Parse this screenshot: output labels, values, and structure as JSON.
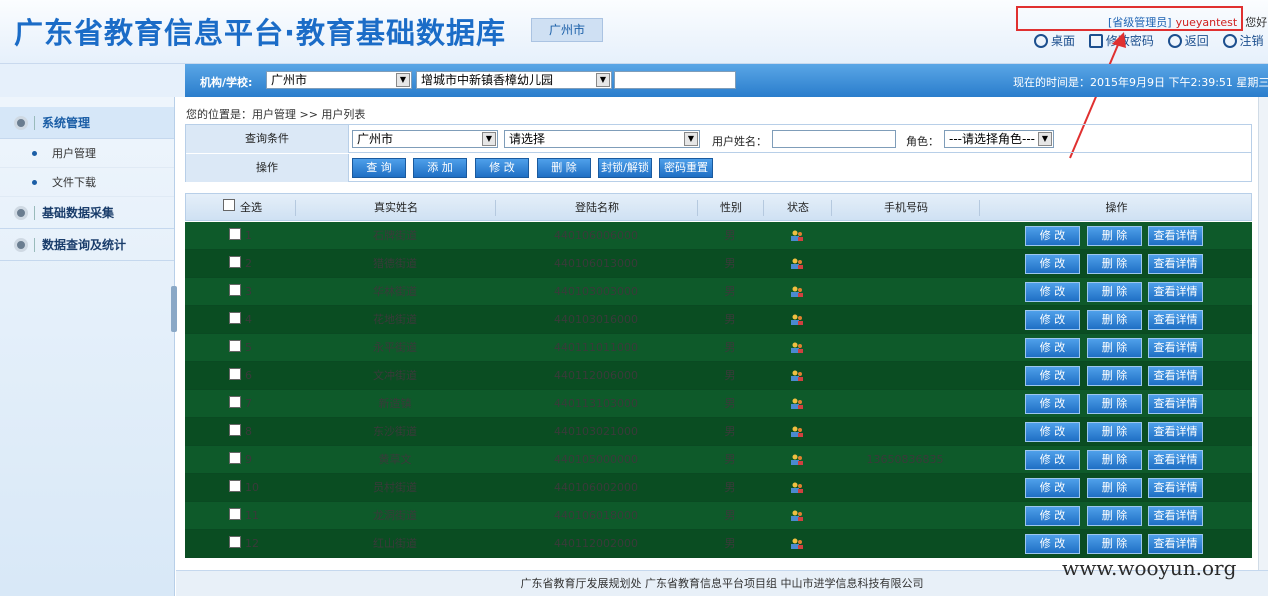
{
  "header": {
    "title": "广东省教育信息平台·教育基础数据库",
    "city": "广州市",
    "role": "[省级管理员]",
    "username": "yueyantest",
    "greeting": "您好",
    "links": [
      "桌面",
      "修改密码",
      "返回",
      "注销"
    ]
  },
  "orgbar": {
    "label": "机构/学校:",
    "city_select": "广州市",
    "school_select": "增城市中新镇香樟幼儿园",
    "time": "现在的时间是：2015年9月9日 下午2:39:51 星期三"
  },
  "sidebar": {
    "sections": [
      {
        "label": "系统管理",
        "items": [
          "用户管理",
          "文件下载"
        ]
      },
      {
        "label": "基础数据采集",
        "items": []
      },
      {
        "label": "数据查询及统计",
        "items": []
      }
    ]
  },
  "breadcrumb": "您的位置是：用户管理 >> 用户列表",
  "query": {
    "label_conditions": "查询条件",
    "label_actions": "操作",
    "city": "广州市",
    "select_placeholder": "请选择",
    "username_label": "用户姓名：",
    "role_label": "角色：",
    "role_select": "---请选择角色---",
    "buttons": [
      "查 询",
      "添 加",
      "修 改",
      "删 除",
      "封锁/解锁",
      "密码重置"
    ]
  },
  "table": {
    "headers": [
      "全选",
      "真实姓名",
      "登陆名称",
      "性别",
      "状态",
      "手机号码",
      "操作"
    ],
    "row_actions": [
      "修 改",
      "删 除",
      "查看详情"
    ],
    "rows": [
      {
        "no": "1",
        "name": "石牌街道",
        "login": "440106006000",
        "gender": "男",
        "phone": ""
      },
      {
        "no": "2",
        "name": "猎德街道",
        "login": "440106013000",
        "gender": "男",
        "phone": ""
      },
      {
        "no": "3",
        "name": "华林街道",
        "login": "440103003000",
        "gender": "男",
        "phone": ""
      },
      {
        "no": "4",
        "name": "花地街道",
        "login": "440103016000",
        "gender": "男",
        "phone": ""
      },
      {
        "no": "5",
        "name": "永平街道",
        "login": "440111011000",
        "gender": "男",
        "phone": ""
      },
      {
        "no": "6",
        "name": "文冲街道",
        "login": "440112006000",
        "gender": "男",
        "phone": ""
      },
      {
        "no": "7",
        "name": "新造镇",
        "login": "440113103000",
        "gender": "男",
        "phone": ""
      },
      {
        "no": "8",
        "name": "东沙街道",
        "login": "440103021000",
        "gender": "男",
        "phone": ""
      },
      {
        "no": "9",
        "name": "黄草文",
        "login": "440105000000",
        "gender": "男",
        "phone": "13650836835"
      },
      {
        "no": "10",
        "name": "员村街道",
        "login": "440106002000",
        "gender": "男",
        "phone": ""
      },
      {
        "no": "11",
        "name": "龙洞街道",
        "login": "440106018000",
        "gender": "男",
        "phone": ""
      },
      {
        "no": "12",
        "name": "红山街道",
        "login": "440112002000",
        "gender": "男",
        "phone": ""
      }
    ]
  },
  "footer": "广东省教育厅发展规划处 广东省教育信息平台项目组 中山市进学信息科技有限公司",
  "watermark": "www.wooyun.org"
}
